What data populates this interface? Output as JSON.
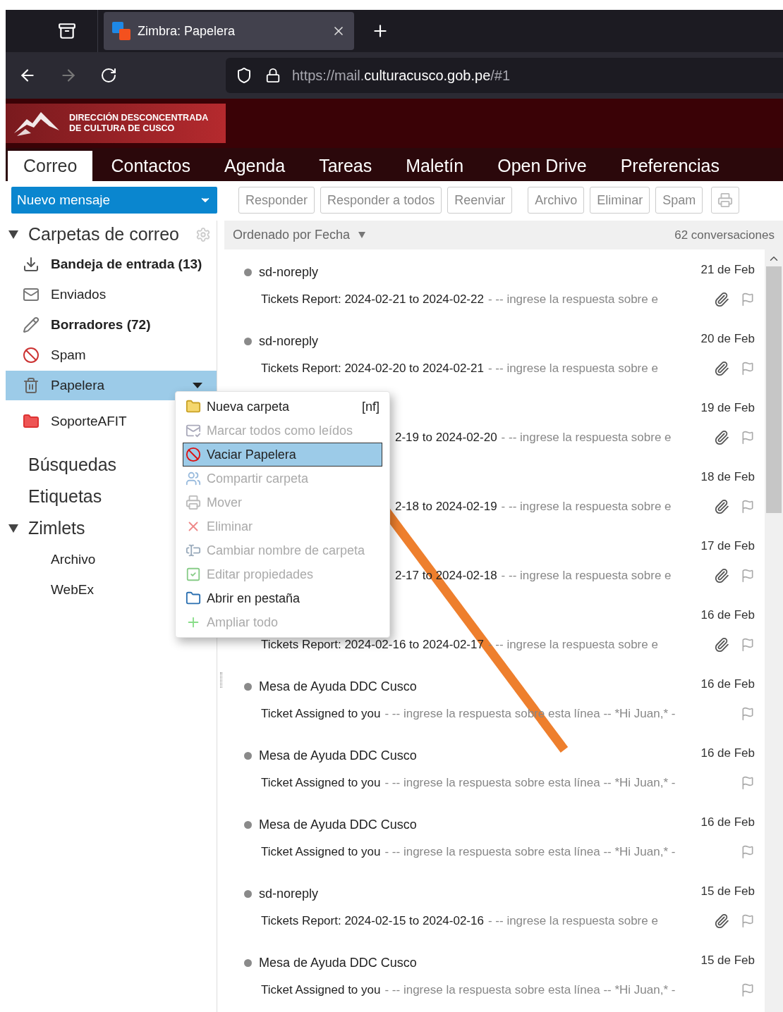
{
  "browser": {
    "tab_title": "Zimbra: Papelera",
    "url": {
      "prefix": "https://mail.",
      "domain": "culturacusco.gob.pe",
      "suffix": "/#1"
    }
  },
  "header": {
    "logo_lines": [
      "DIRECCIÓN DESCONCENTRADA",
      "DE CULTURA DE CUSCO"
    ]
  },
  "app_tabs": [
    {
      "label": "Correo",
      "selected": true
    },
    {
      "label": "Contactos",
      "selected": false
    },
    {
      "label": "Agenda",
      "selected": false
    },
    {
      "label": "Tareas",
      "selected": false
    },
    {
      "label": "Maletín",
      "selected": false
    },
    {
      "label": "Open Drive",
      "selected": false
    },
    {
      "label": "Preferencias",
      "selected": false
    }
  ],
  "toolbar": {
    "new_message": "Nuevo mensaje",
    "buttons": [
      "Responder",
      "Responder a todos",
      "Reenviar",
      "Archivo",
      "Eliminar",
      "Spam"
    ]
  },
  "sidebar": {
    "mail_folders": {
      "title": "Carpetas de correo",
      "expanded": true,
      "items": [
        {
          "label": "Bandeja de entrada (13)",
          "kind": "inbox",
          "bold": true,
          "selected": false
        },
        {
          "label": "Enviados",
          "kind": "sent",
          "bold": false,
          "selected": false
        },
        {
          "label": "Borradores (72)",
          "kind": "drafts",
          "bold": true,
          "selected": false
        },
        {
          "label": "Spam",
          "kind": "spam",
          "bold": false,
          "selected": false
        },
        {
          "label": "Papelera",
          "kind": "trash",
          "bold": false,
          "selected": true
        },
        {
          "label": "SoporteAFIT",
          "kind": "folder",
          "bold": false,
          "selected": false
        }
      ]
    },
    "searches": "Búsquedas",
    "tags": "Etiquetas",
    "zimlets": {
      "title": "Zimlets",
      "expanded": true,
      "items": [
        "Archivo",
        "WebEx"
      ]
    }
  },
  "message_list": {
    "sort_label": "Ordenado por Fecha",
    "count": "62 conversaciones",
    "messages": [
      {
        "kind": "full",
        "sender": "sd-noreply",
        "date": "21 de Feb",
        "subject": "Tickets Report: 2024-02-21 to 2024-02-22",
        "preview": "- -- ingrese la respuesta sobre e",
        "attachment": true
      },
      {
        "kind": "full",
        "sender": "sd-noreply",
        "date": "20 de Feb",
        "subject": "Tickets Report: 2024-02-20 to 2024-02-21",
        "preview": "- -- ingrese la respuesta sobre e",
        "attachment": true
      },
      {
        "kind": "partial",
        "date": "19 de Feb",
        "subject": "2-19 to 2024-02-20",
        "preview": "- -- ingrese la respuesta sobre e",
        "attachment": true
      },
      {
        "kind": "partial",
        "date": "18 de Feb",
        "subject": "2-18 to 2024-02-19",
        "preview": "- -- ingrese la respuesta sobre e",
        "attachment": true
      },
      {
        "kind": "partial",
        "date": "17 de Feb",
        "subject": "2-17 to 2024-02-18",
        "preview": "- -- ingrese la respuesta sobre e",
        "attachment": true
      },
      {
        "kind": "covered",
        "date": "16 de Feb",
        "subject": "Tickets Report: 2024-02-16 to 2024-02-17",
        "preview": "- -- ingrese la respuesta sobre e",
        "attachment": true
      },
      {
        "kind": "full",
        "sender": "Mesa de Ayuda DDC Cusco",
        "date": "16 de Feb",
        "subject": "Ticket Assigned to you",
        "preview": "- -- ingrese la respuesta sobre esta línea -- *Hi Juan,* -",
        "attachment": false
      },
      {
        "kind": "full",
        "sender": "Mesa de Ayuda DDC Cusco",
        "date": "16 de Feb",
        "subject": "Ticket Assigned to you",
        "preview": "- -- ingrese la respuesta sobre esta línea -- *Hi Juan,* -",
        "attachment": false
      },
      {
        "kind": "full",
        "sender": "Mesa de Ayuda DDC Cusco",
        "date": "16 de Feb",
        "subject": "Ticket Assigned to you",
        "preview": "- -- ingrese la respuesta sobre esta línea -- *Hi Juan,* -",
        "attachment": false
      },
      {
        "kind": "full",
        "sender": "sd-noreply",
        "date": "15 de Feb",
        "subject": "Tickets Report: 2024-02-15 to 2024-02-16",
        "preview": "- -- ingrese la respuesta sobre e",
        "attachment": true
      },
      {
        "kind": "full",
        "sender": "Mesa de Ayuda DDC Cusco",
        "date": "15 de Feb",
        "subject": "Ticket Assigned to you",
        "preview": "- -- ingrese la respuesta sobre esta línea -- *Hi Juan,* -",
        "attachment": false
      }
    ]
  },
  "context_menu": [
    {
      "label": "Nueva carpeta",
      "kind": "new-folder",
      "shortcut": "[nf]",
      "disabled": false,
      "selected": false
    },
    {
      "label": "Marcar todos como leídos",
      "kind": "mark-read",
      "disabled": true,
      "selected": false
    },
    {
      "label": "Vaciar Papelera",
      "kind": "empty",
      "disabled": false,
      "selected": true
    },
    {
      "label": "Compartir carpeta",
      "kind": "share",
      "disabled": true,
      "selected": false
    },
    {
      "label": "Mover",
      "kind": "move",
      "disabled": true,
      "selected": false
    },
    {
      "label": "Eliminar",
      "kind": "delete",
      "disabled": true,
      "selected": false
    },
    {
      "label": "Cambiar nombre de carpeta",
      "kind": "rename",
      "disabled": true,
      "selected": false
    },
    {
      "label": "Editar propiedades",
      "kind": "edit",
      "disabled": true,
      "selected": false
    },
    {
      "label": "Abrir en pestaña",
      "kind": "open-tab",
      "disabled": false,
      "selected": false
    },
    {
      "label": "Ampliar todo",
      "kind": "expand",
      "disabled": true,
      "selected": false
    }
  ]
}
